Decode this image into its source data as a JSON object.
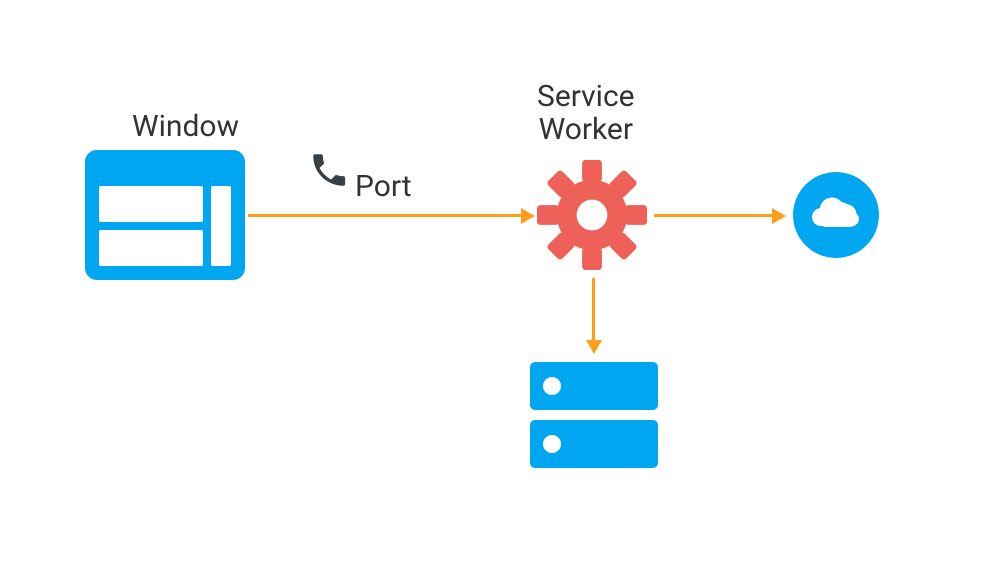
{
  "labels": {
    "window": "Window",
    "port": "Port",
    "service_worker_line1": "Service",
    "service_worker_line2": "Worker"
  },
  "icons": {
    "window": "window-icon",
    "phone": "phone-icon",
    "gear": "gear-icon",
    "cloud": "cloud-icon",
    "cache": "cache-icon"
  },
  "colors": {
    "blue": "#00a7f0",
    "arrow": "#ff9e1b",
    "gear": "#ed6158",
    "text": "#333333",
    "phone": "#3a3f44"
  },
  "arrows": [
    {
      "from": "window",
      "to": "service_worker",
      "dir": "right"
    },
    {
      "from": "service_worker",
      "to": "cloud",
      "dir": "right"
    },
    {
      "from": "service_worker",
      "to": "cache",
      "dir": "down"
    }
  ]
}
